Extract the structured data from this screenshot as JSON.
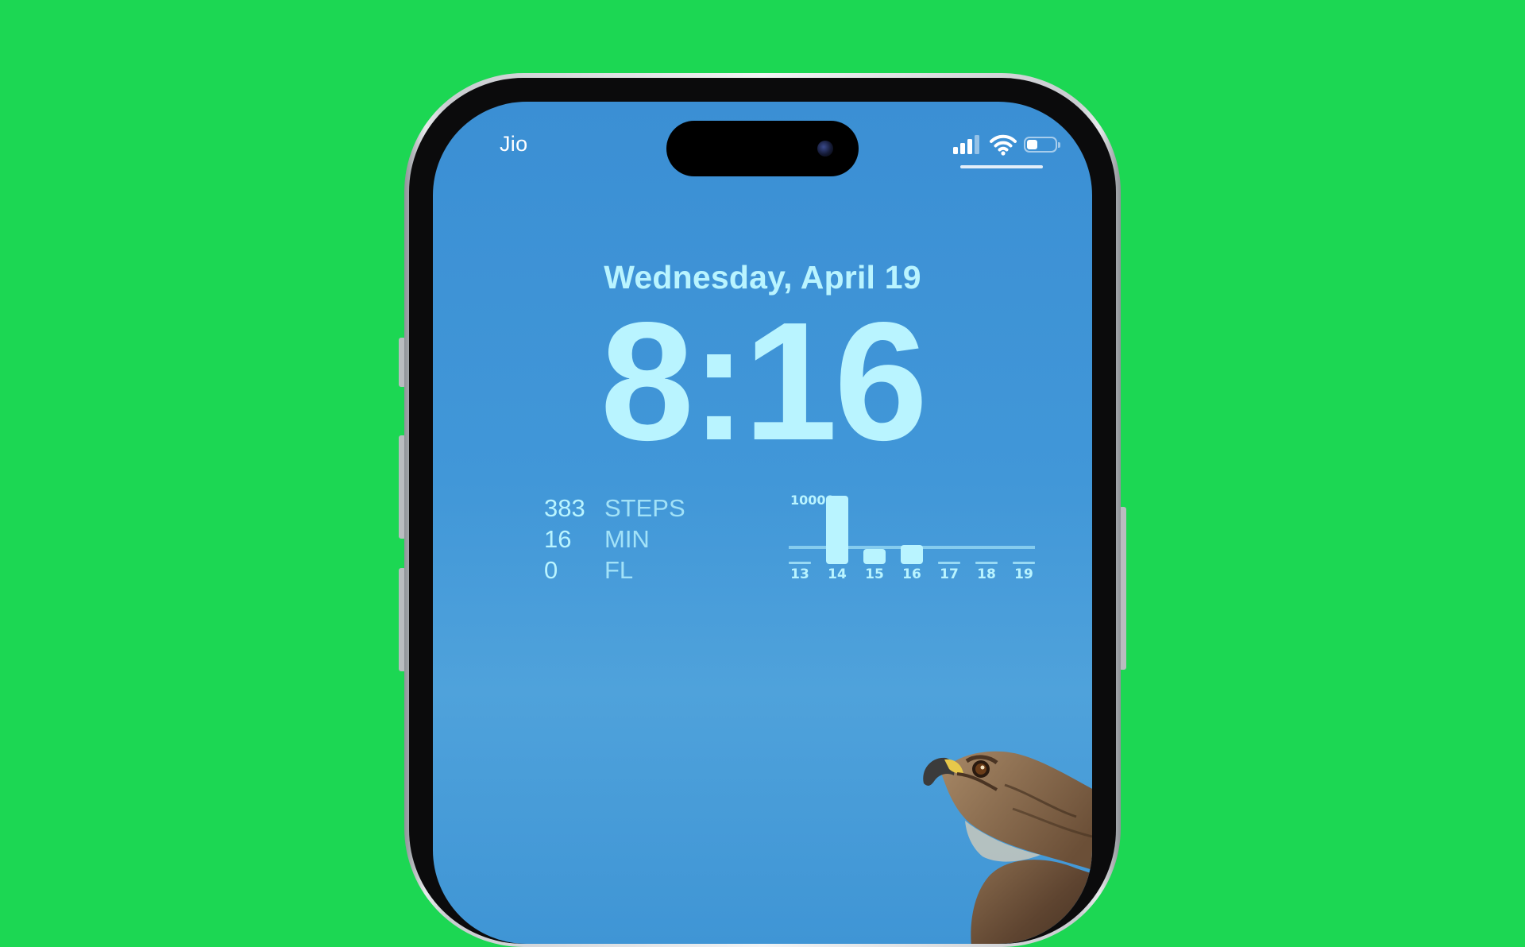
{
  "status_bar": {
    "carrier": "Jio",
    "signal_bars_filled": 3,
    "battery_level": 0.4
  },
  "lock_screen": {
    "date": "Wednesday, April 19",
    "time": "8:16"
  },
  "activity_widget": {
    "rows": [
      {
        "value": "383",
        "label": "STEPS"
      },
      {
        "value": "16",
        "label": "MIN"
      },
      {
        "value": "0",
        "label": "FL"
      }
    ]
  },
  "chart_data": {
    "type": "bar",
    "title": "",
    "max_label": "10000",
    "categories": [
      "13",
      "14",
      "15",
      "16",
      "17",
      "18",
      "19"
    ],
    "values": [
      0,
      10000,
      2200,
      2800,
      0,
      0,
      0
    ],
    "goal": 2500,
    "ylim": [
      0,
      10000
    ],
    "grid": false,
    "bar_color": "#b9f4ff"
  },
  "colors": {
    "background": "#1cd753",
    "screen_blue": "#4197d8",
    "accent_text": "#b9f4ff"
  },
  "icons": [
    "cellular-signal-icon",
    "wifi-icon",
    "battery-icon",
    "front-camera-icon"
  ]
}
